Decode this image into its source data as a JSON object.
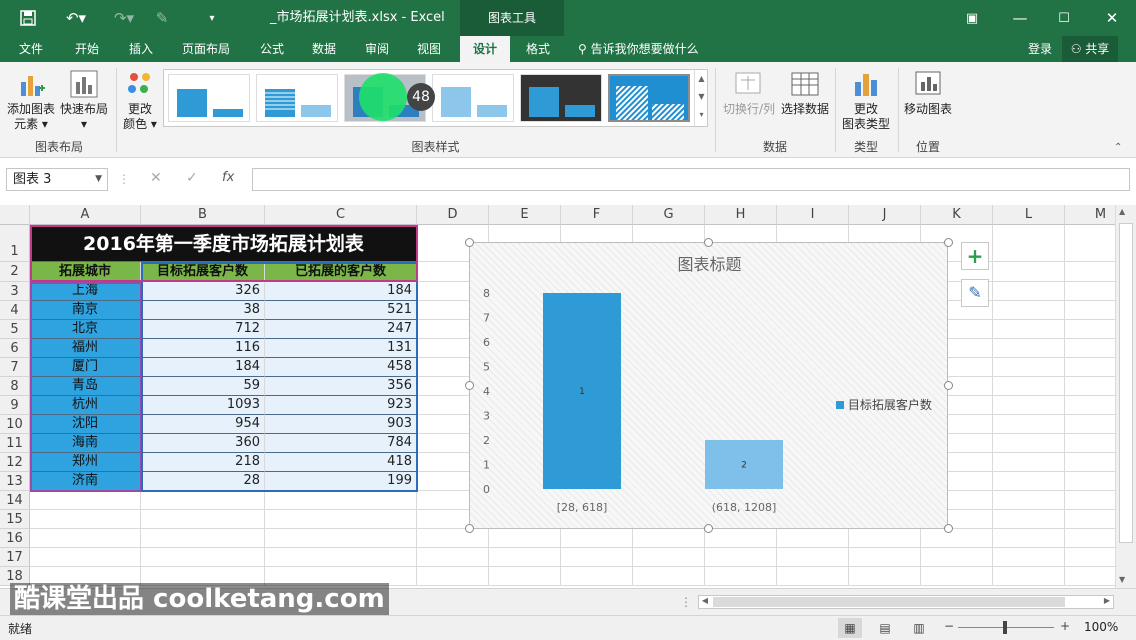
{
  "app": {
    "doc_title": "_市场拓展计划表.xlsx - Excel",
    "context_tools": "图表工具",
    "login": "登录",
    "share": "共享"
  },
  "tabs": [
    "文件",
    "开始",
    "插入",
    "页面布局",
    "公式",
    "数据",
    "审阅",
    "视图",
    "设计",
    "格式"
  ],
  "tell_me": "告诉我你想要做什么",
  "ribbon": {
    "add_element": "添加图表元素",
    "add_element_l1": "添加图表",
    "add_element_l2": "元素",
    "quick_layout": "快速布局",
    "change_colors_l1": "更改",
    "change_colors_l2": "颜色",
    "group_layout": "图表布局",
    "group_styles": "图表样式",
    "switch_rowcol": "切换行/列",
    "select_data": "选择数据",
    "group_data": "数据",
    "change_type_l1": "更改",
    "change_type_l2": "图表类型",
    "group_type": "类型",
    "move_chart": "移动图表",
    "group_location": "位置",
    "badge": "48"
  },
  "namebox": "图表 3",
  "fx": "fx",
  "columns": [
    "A",
    "B",
    "C",
    "D",
    "E",
    "F",
    "G",
    "H",
    "I",
    "J",
    "K",
    "L",
    "M"
  ],
  "rows": [
    "1",
    "2",
    "3",
    "4",
    "5",
    "6",
    "7",
    "8",
    "9",
    "10",
    "11",
    "12",
    "13",
    "14",
    "15",
    "16",
    "17",
    "18"
  ],
  "sheet": {
    "title": "2016年第一季度市场拓展计划表",
    "headers": [
      "拓展城市",
      "目标拓展客户数",
      "已拓展的客户数"
    ],
    "data": [
      [
        "上海",
        "326",
        "184"
      ],
      [
        "南京",
        "38",
        "521"
      ],
      [
        "北京",
        "712",
        "247"
      ],
      [
        "福州",
        "116",
        "131"
      ],
      [
        "厦门",
        "184",
        "458"
      ],
      [
        "青岛",
        "59",
        "356"
      ],
      [
        "杭州",
        "1093",
        "923"
      ],
      [
        "沈阳",
        "954",
        "903"
      ],
      [
        "海南",
        "360",
        "784"
      ],
      [
        "郑州",
        "218",
        "418"
      ],
      [
        "济南",
        "28",
        "199"
      ]
    ]
  },
  "chart_data": {
    "type": "bar",
    "title": "图表标题",
    "categories": [
      "[28, 618]",
      "(618, 1208]"
    ],
    "series": [
      {
        "name": "目标拓展客户数",
        "values": [
          8,
          2
        ]
      }
    ],
    "data_labels": [
      "1",
      "2"
    ],
    "y_ticks": [
      "0",
      "1",
      "2",
      "3",
      "4",
      "5",
      "6",
      "7",
      "8"
    ],
    "ylim": [
      0,
      8
    ],
    "legend_position": "right",
    "grid": false,
    "color": "#2e9bd6"
  },
  "status": {
    "ready": "就绪",
    "zoom": "100%"
  },
  "watermark": "酷课堂出品 coolketang.com"
}
